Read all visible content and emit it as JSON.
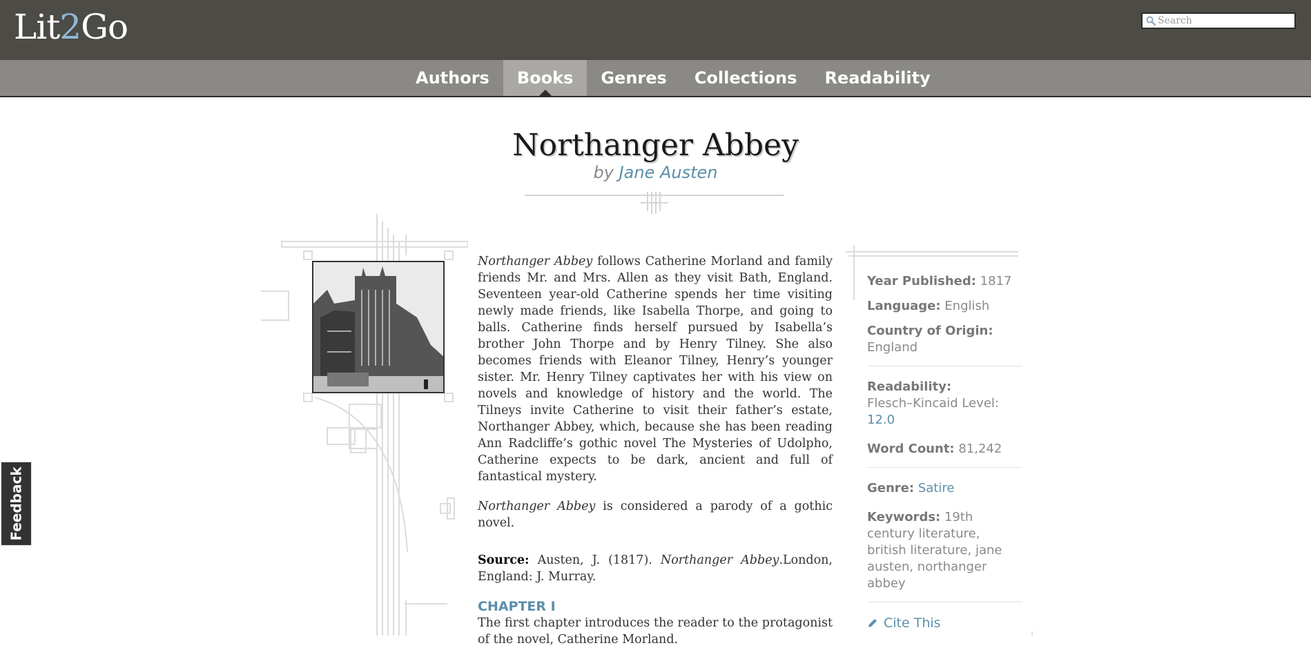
{
  "header": {
    "logo_left": "Lit",
    "logo_accent": "2",
    "logo_right": "Go",
    "search_placeholder": "Search",
    "search_icon": "magnifier-icon"
  },
  "nav": {
    "items": [
      {
        "label": "Authors"
      },
      {
        "label": "Books",
        "active": true
      },
      {
        "label": "Genres"
      },
      {
        "label": "Collections"
      },
      {
        "label": "Readability"
      }
    ]
  },
  "book": {
    "title": "Northanger Abbey",
    "by": "by",
    "author": "Jane Austen",
    "summary_title": "Northanger Abbey",
    "summary_rest": " follows Catherine Morland and family friends Mr. and Mrs. Allen as they visit Bath, England. Seventeen year-old Catherine spends her time visiting newly made friends, like Isabella Thorpe, and going to balls. Catherine finds herself pursued by Isabella’s brother John Thorpe and by Henry Tilney. She also becomes friends with Eleanor Tilney, Henry’s younger sister. Mr. Henry Tilney captivates her with his view on novels and knowledge of history and the world. The Tilneys invite Catherine to visit their father’s estate, Northanger Abbey, which, because she has been reading Ann Radcliffe’s gothic novel The Mysteries of Udolpho, Catherine expects to be dark, ancient and full of fantastical mystery.",
    "parody_title": "Northanger Abbey",
    "parody_rest": " is considered a parody of a gothic novel.",
    "source_label": "Source:",
    "source_pre": " Austen, J. (1817). ",
    "source_title": "Northanger Abbey",
    "source_post": ".London, England: J. Murray.",
    "chapter_heading": "CHAPTER I",
    "chapter_text": "The first chapter introduces the reader to the protagonist of the novel, Catherine Morland."
  },
  "sidebar": {
    "year_label": "Year Published:",
    "year_value": " 1817",
    "language_label": "Language:",
    "language_value": " English",
    "origin_label": "Country of Origin:",
    "origin_value": "England",
    "readability_label": "Readability:",
    "readability_text": "Flesch–Kincaid Level:",
    "readability_value": "12.0",
    "wordcount_label": "Word Count:",
    "wordcount_value": " 81,242",
    "genre_label": "Genre:",
    "genre_value": "Satire",
    "keywords_label": "Keywords:",
    "keywords_value": " 19th century literature, british literature, jane austen, northanger abbey",
    "cite_label": "Cite This",
    "cite_icon": "pencil-icon"
  },
  "feedback": {
    "label": "Feedback"
  },
  "colors": {
    "header_bg": "#4d4b46",
    "nav_bg": "#8a8985",
    "nav_active_bg": "#a9a8a4",
    "link": "#5b8faa",
    "logo_accent": "#8fb7d6"
  }
}
